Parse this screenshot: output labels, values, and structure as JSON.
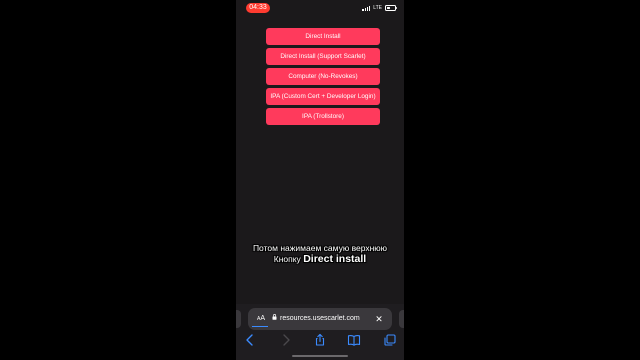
{
  "status_bar": {
    "time": "04:33",
    "network": "LTE"
  },
  "install_options": [
    {
      "label": "Direct Install"
    },
    {
      "label": "Direct Install (Support Scarlet)"
    },
    {
      "label": "Computer (No-Revokes)"
    },
    {
      "label": "IPA (Custom Cert + Developer Login)"
    },
    {
      "label": "IPA (Trollstore)"
    }
  ],
  "caption": {
    "line1": "Потом нажимаем самую верхнюю",
    "line2_prefix": "Кнопку",
    "line2_emphasis": "Direct install"
  },
  "address_bar": {
    "text_size_label_small": "A",
    "text_size_label_large": "A",
    "url": "resources.usescarlet.com"
  },
  "colors": {
    "button": "#ff3a5c",
    "time_pill": "#ff3b30",
    "toolbar_icon": "#3b8bff"
  },
  "icons": {
    "lock": "lock-icon",
    "close": "close-icon",
    "back": "chevron-left-icon",
    "forward": "chevron-right-icon",
    "share": "share-icon",
    "bookmarks": "book-icon",
    "tabs": "tabs-icon"
  }
}
